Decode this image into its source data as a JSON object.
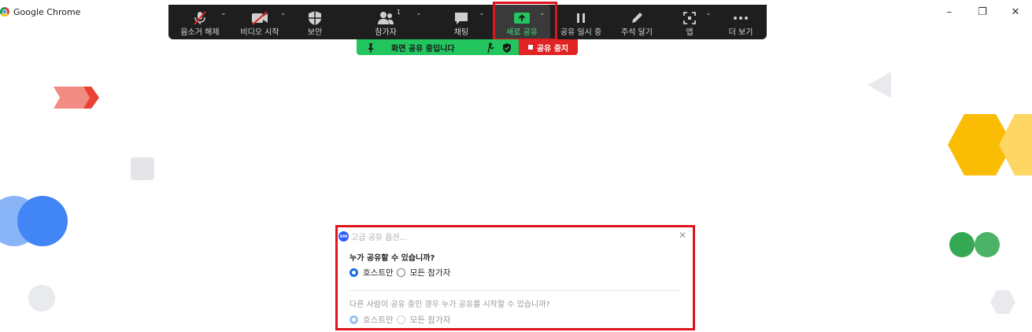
{
  "browser": {
    "title": "Google Chrome",
    "icon": "chrome-icon",
    "controls": [
      "minimize-icon",
      "restore-icon",
      "close-icon"
    ]
  },
  "toolbar": {
    "items": [
      {
        "label": "음소거 해제",
        "icon": "microphone-muted-icon",
        "caret": true
      },
      {
        "label": "비디오 시작",
        "icon": "video-off-icon",
        "caret": true
      },
      {
        "label": "보안",
        "icon": "shield-icon",
        "caret": false
      },
      {
        "label": "참가자",
        "icon": "participants-icon",
        "caret": true,
        "count": "1"
      },
      {
        "label": "채팅",
        "icon": "chat-icon",
        "caret": true
      },
      {
        "label": "새로 공유",
        "icon": "share-screen-icon",
        "caret": true,
        "active": true
      },
      {
        "label": "공유 일시 중",
        "icon": "pause-icon",
        "caret": false
      },
      {
        "label": "주석 달기",
        "icon": "pencil-icon",
        "caret": false
      },
      {
        "label": "앱",
        "icon": "apps-icon",
        "caret": true
      },
      {
        "label": "더 보기",
        "icon": "more-icon",
        "caret": false
      }
    ]
  },
  "banner": {
    "text": "화면 공유 중입니다",
    "stop_label": "공유 중지",
    "color": "#22c55e",
    "stop_color": "#e02424"
  },
  "advanced_panel": {
    "logo": "zm",
    "title": "고급 공유 옵션...",
    "q1": "누가 공유할 수 있습니까?",
    "q1_options": [
      "호스트만",
      "모든 참가자"
    ],
    "q1_selected": 0,
    "q2": "다른 사람이 공유 중인 경우 누가 공유를 시작할 수 있습니까?",
    "q2_options": [
      "호스트만",
      "모든 참가자"
    ],
    "q2_selected": 0
  },
  "colors": {
    "toolbar_bg": "#1e1e1e",
    "highlight": "#e0141e",
    "radio_on": "#1a6fe0"
  }
}
